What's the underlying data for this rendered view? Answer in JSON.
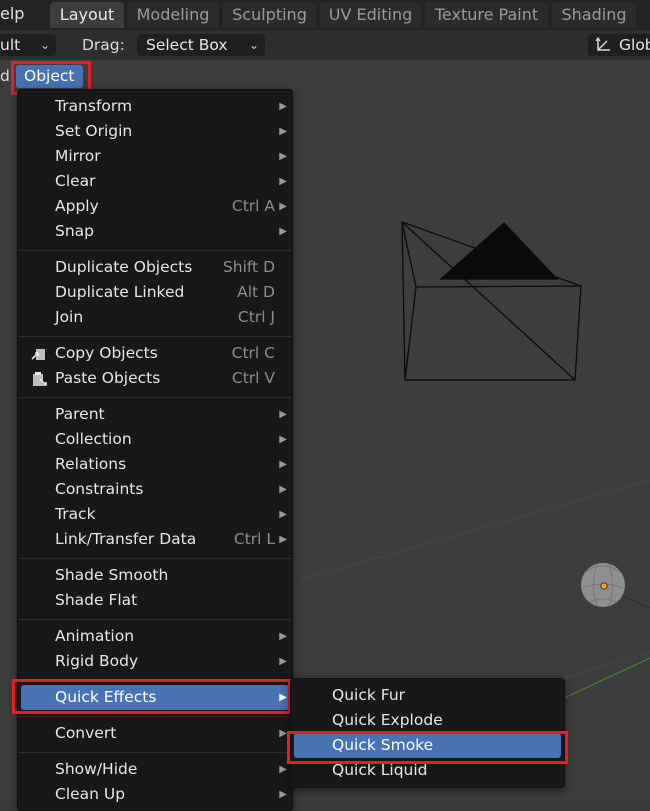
{
  "topbar": {
    "help_fragment": "elp",
    "tabs": [
      "Layout",
      "Modeling",
      "Sculpting",
      "UV Editing",
      "Texture Paint",
      "Shading"
    ]
  },
  "header": {
    "mode_fragment": "ult",
    "drag_label": "Drag:",
    "drag_value": "Select Box",
    "orientation": "Glob"
  },
  "viewport": {
    "mode_fragment": "d",
    "object_menu": "Object"
  },
  "object_menu": {
    "items": [
      {
        "label": "Transform",
        "shortcut": "",
        "submenu": true
      },
      {
        "label": "Set Origin",
        "shortcut": "",
        "submenu": true
      },
      {
        "label": "Mirror",
        "shortcut": "",
        "submenu": true
      },
      {
        "label": "Clear",
        "shortcut": "",
        "submenu": true
      },
      {
        "label": "Apply",
        "shortcut": "Ctrl A",
        "submenu": true
      },
      {
        "label": "Snap",
        "shortcut": "",
        "submenu": true
      },
      {
        "label": "Duplicate Objects",
        "shortcut": "Shift D",
        "submenu": false
      },
      {
        "label": "Duplicate Linked",
        "shortcut": "Alt D",
        "submenu": false
      },
      {
        "label": "Join",
        "shortcut": "Ctrl J",
        "submenu": false
      },
      {
        "label": "Copy Objects",
        "shortcut": "Ctrl C",
        "submenu": false
      },
      {
        "label": "Paste Objects",
        "shortcut": "Ctrl V",
        "submenu": false
      },
      {
        "label": "Parent",
        "shortcut": "",
        "submenu": true
      },
      {
        "label": "Collection",
        "shortcut": "",
        "submenu": true
      },
      {
        "label": "Relations",
        "shortcut": "",
        "submenu": true
      },
      {
        "label": "Constraints",
        "shortcut": "",
        "submenu": true
      },
      {
        "label": "Track",
        "shortcut": "",
        "submenu": true
      },
      {
        "label": "Link/Transfer Data",
        "shortcut": "Ctrl L",
        "submenu": true
      },
      {
        "label": "Shade Smooth",
        "shortcut": "",
        "submenu": false
      },
      {
        "label": "Shade Flat",
        "shortcut": "",
        "submenu": false
      },
      {
        "label": "Animation",
        "shortcut": "",
        "submenu": true
      },
      {
        "label": "Rigid Body",
        "shortcut": "",
        "submenu": true
      },
      {
        "label": "Quick Effects",
        "shortcut": "",
        "submenu": true
      },
      {
        "label": "Convert",
        "shortcut": "",
        "submenu": true
      },
      {
        "label": "Show/Hide",
        "shortcut": "",
        "submenu": true
      },
      {
        "label": "Clean Up",
        "shortcut": "",
        "submenu": true
      }
    ]
  },
  "quick_effects_menu": {
    "items": [
      "Quick Fur",
      "Quick Explode",
      "Quick Smoke",
      "Quick Liquid"
    ]
  },
  "colors": {
    "menu_bg": "#181818",
    "highlight": "#4772b3",
    "annotation_red": "#e0202a",
    "viewport_bg": "#3d3d3d"
  },
  "icons": {
    "copy": "copy-objects-icon",
    "paste": "paste-objects-icon",
    "submenu": "submenu-arrow-icon"
  }
}
